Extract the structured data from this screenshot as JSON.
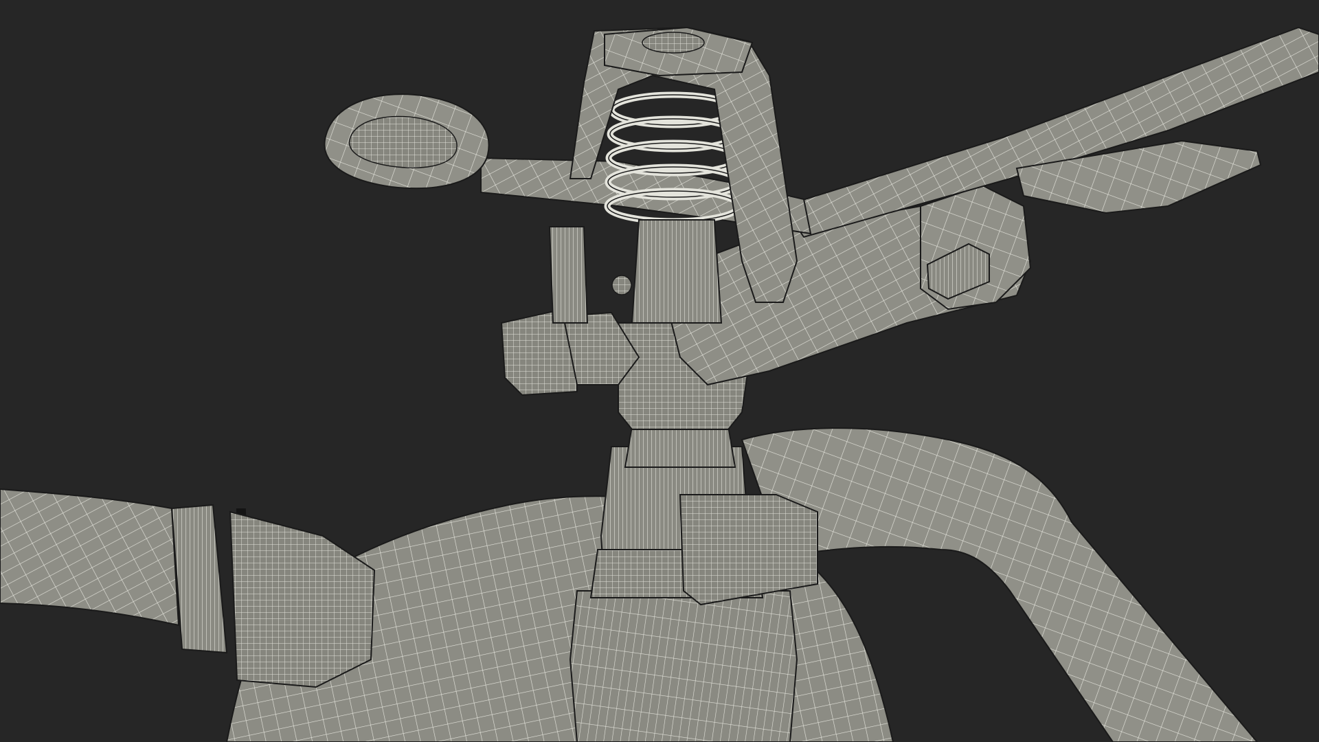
{
  "scene": {
    "subject": "impact-sprinkler-wireframe",
    "background_color": "#262626",
    "surface_color": "#8c8c84",
    "surface_light": "#a3a39a",
    "surface_dark": "#6b6b64",
    "wire_color": "#e4e4dc",
    "outline_color": "#1a1a1a"
  }
}
